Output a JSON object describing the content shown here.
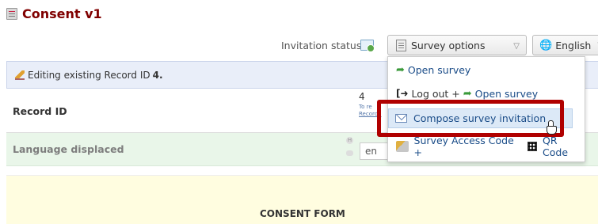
{
  "header": {
    "title": "Consent v1",
    "title_icon": "form-icon"
  },
  "toolbar": {
    "invitation_status_label": "Invitation status:",
    "invitation_status_icon": "invitation-envelope-icon",
    "survey_options_label": "Survey options",
    "language_label": "English"
  },
  "dropdown": {
    "items": [
      {
        "label": "Open survey",
        "icon": "green-arrow-icon"
      },
      {
        "prefix": "Log out +",
        "label": "Open survey",
        "icon": "logout-icon"
      },
      {
        "label": "Compose survey invitation",
        "icon": "envelope-icon"
      },
      {
        "prefix": "Survey Access Code +",
        "label": "QR Code",
        "icon": "key-icon"
      }
    ]
  },
  "editing": {
    "text": "Editing existing Record ID",
    "record_id": "4."
  },
  "fields": {
    "record_id": {
      "label": "Record ID",
      "value": "4",
      "note_line1": "To re",
      "note_line2": "Record I"
    },
    "language": {
      "label": "Language displaced",
      "value": "en"
    },
    "consent": {
      "title": "CONSENT FORM"
    }
  },
  "colors": {
    "title": "#800000",
    "highlight_box": "#b00000",
    "link": "#1a4c88"
  }
}
